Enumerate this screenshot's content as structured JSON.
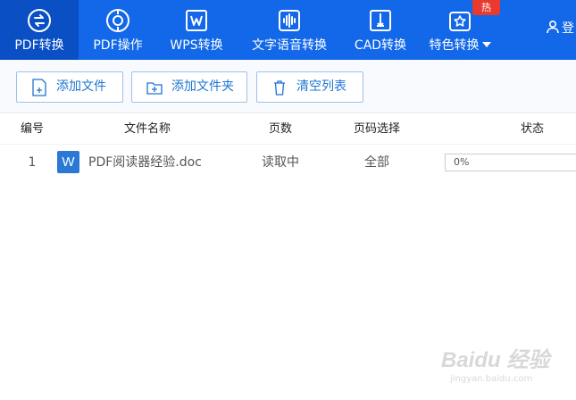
{
  "nav": {
    "tabs": [
      {
        "label": "PDF转换",
        "icon": "pdf-convert-icon",
        "active": true
      },
      {
        "label": "PDF操作",
        "icon": "pdf-operate-icon",
        "active": false
      },
      {
        "label": "WPS转换",
        "icon": "wps-icon",
        "active": false
      },
      {
        "label": "文字语音转换",
        "icon": "audio-wave-icon",
        "active": false
      },
      {
        "label": "CAD转换",
        "icon": "cad-icon",
        "active": false
      },
      {
        "label": "特色转换",
        "icon": "star-convert-icon",
        "active": false
      }
    ],
    "hot_badge": "热",
    "login": "登",
    "accent": "#1268e8",
    "active_bg": "#0a4fc4"
  },
  "toolbar": {
    "add_file": "添加文件",
    "add_folder": "添加文件夹",
    "clear_list": "清空列表"
  },
  "table": {
    "columns": [
      "编号",
      "文件名称",
      "页数",
      "页码选择",
      "状态"
    ],
    "rows": [
      {
        "index": "1",
        "file_icon": "W",
        "name": "PDF阅读器经验.doc",
        "pages": "读取中",
        "page_select": "全部",
        "progress": 0,
        "status": "0%"
      }
    ]
  },
  "watermark": {
    "brand": "Baidu 经验",
    "url": "jingyan.baidu.com"
  }
}
